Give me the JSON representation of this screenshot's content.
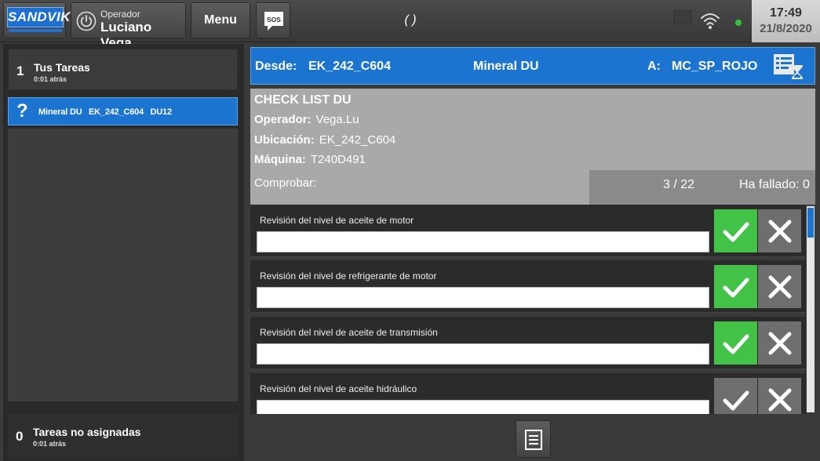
{
  "header": {
    "logo_text": "SANDVIK",
    "operator_label": "Operador",
    "operator_name": "Luciano Vega",
    "menu_label": "Menu",
    "sos_label": "SOS",
    "center_text": "( )",
    "time": "17:49",
    "date": "21/8/2020",
    "icons": [
      "power-icon",
      "sos-icon",
      "wifi-icon",
      "status-dot"
    ]
  },
  "sidebar": {
    "my_tasks": {
      "count": "1",
      "title": "Tus Tareas",
      "subtitle": "0:01 atrás"
    },
    "active_task": {
      "status_symbol": "?",
      "label": "Mineral DU   EK_242_C604   DU12"
    },
    "unassigned": {
      "count": "0",
      "title": "Tareas no asignadas",
      "subtitle": "0:01 atrás"
    }
  },
  "route": {
    "from_label": "Desde:",
    "from_value": "EK_242_C604",
    "material": "Mineral DU",
    "to_label": "A:",
    "to_value": "MC_SP_ROJO"
  },
  "checklist": {
    "title": "CHECK LIST DU",
    "operator_label": "Operador:",
    "operator_value": "Vega.Lu",
    "location_label": "Ubicación:",
    "location_value": "EK_242_C604",
    "machine_label": "Máquina:",
    "machine_value": "T240D491",
    "check_label": "Comprobar:",
    "progress": "3 / 22",
    "failed": "Ha fallado: 0",
    "items": [
      {
        "label": "Revisión del nivel de aceite de motor",
        "value": "",
        "ok_selected": true
      },
      {
        "label": "Revisión del nivel de refrigerante de motor",
        "value": "",
        "ok_selected": true
      },
      {
        "label": "Revisión del nivel de aceite de transmisión",
        "value": "",
        "ok_selected": true
      },
      {
        "label": "Revisión del nivel de aceite hidráulico",
        "value": "",
        "ok_selected": false
      }
    ]
  },
  "colors": {
    "accent_blue": "#1b74d0",
    "ok_green": "#43c248",
    "neutral_gray": "#6e6e6e"
  }
}
